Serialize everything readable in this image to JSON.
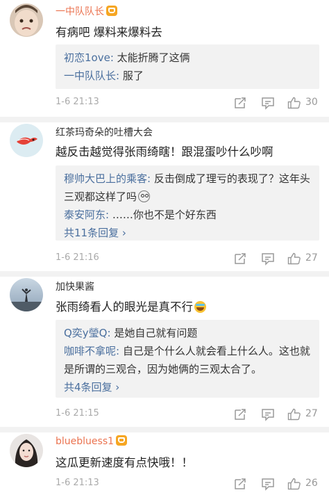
{
  "colors": {
    "vip_name": "#eb7350",
    "link_blue": "#4a6f9e",
    "meta_grey": "#aaaaaa",
    "reply_bg": "#f2f2f2"
  },
  "comments": [
    {
      "user": "一中队队长",
      "vip": true,
      "text": "有病吧 爆料来爆料去",
      "replies": [
        {
          "user": "初恋1ove:",
          "text": " 太能折腾了这俩"
        },
        {
          "user": "一中队队长:",
          "text": " 服了"
        }
      ],
      "more": "",
      "time": "1-6 21:13",
      "likes": "30",
      "icons": [
        "share-icon",
        "comment-icon",
        "thumbs-up-icon"
      ]
    },
    {
      "user": "红茶玛奇朵的吐槽大会",
      "vip": false,
      "text": "越反击越觉得张雨绮瞎！跟混蛋吵什么吵啊",
      "replies": [
        {
          "user": "穆帅大巴上的乘客:",
          "text": " 反击倒成了理亏的表现了？这年头三观都这样了吗"
        },
        {
          "user": "泰安阿东:",
          "text": " ……你也不是个好东西"
        }
      ],
      "more": "共11条回复 ›",
      "time": "1-6 21:16",
      "likes": "27"
    },
    {
      "user": "加快果酱",
      "vip": false,
      "text": "张雨绮看人的眼光是真不行",
      "replies": [
        {
          "user": "Q奕y瑩Q:",
          "text": " 是她自己就有问题"
        },
        {
          "user": "咖啡不拿呢:",
          "text": " 自己是个什么人就会看上什么人。这也就是所谓的三观合，因为她俩的三观太合了。"
        }
      ],
      "more": "共4条回复 ›",
      "time": "1-6 21:15",
      "likes": "27"
    },
    {
      "user": "bluebluess1",
      "vip": true,
      "text": "这瓜更新速度有点快哦！！",
      "replies": [],
      "more": "",
      "time": "1-6 21:13",
      "likes": "26"
    }
  ]
}
